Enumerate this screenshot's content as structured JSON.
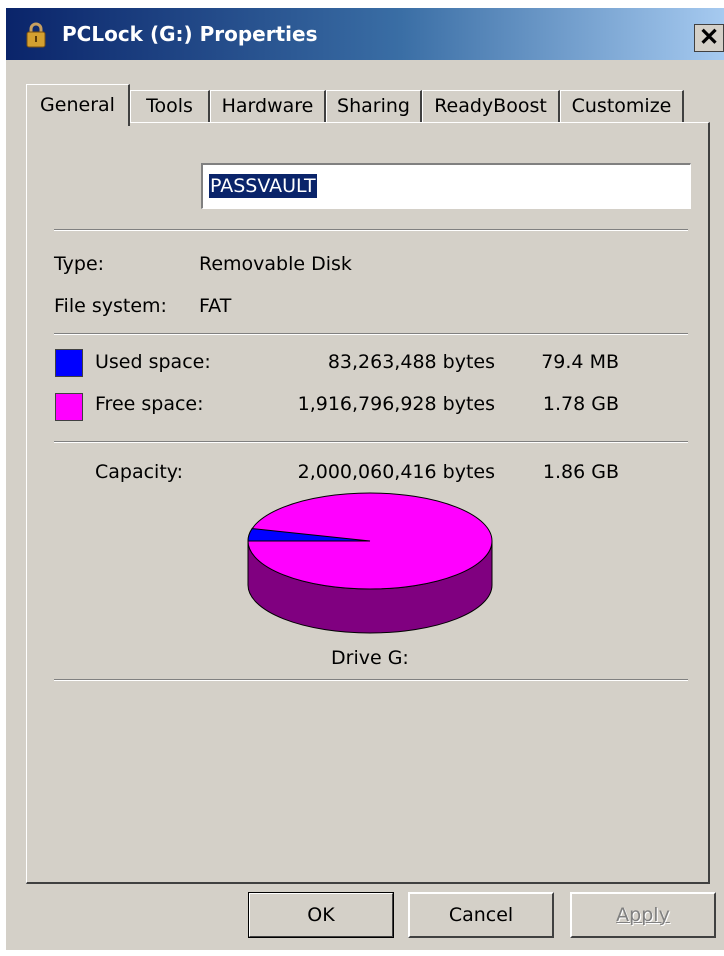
{
  "window": {
    "title": "PCLock (G:) Properties",
    "close_glyph": "✕"
  },
  "tabs": [
    {
      "label": "General",
      "active": true
    },
    {
      "label": "Tools",
      "active": false
    },
    {
      "label": "Hardware",
      "active": false
    },
    {
      "label": "Sharing",
      "active": false
    },
    {
      "label": "ReadyBoost",
      "active": false
    },
    {
      "label": "Customize",
      "active": false
    }
  ],
  "general": {
    "volume_label": "PASSVAULT",
    "type_label": "Type:",
    "type_value": "Removable Disk",
    "fs_label": "File system:",
    "fs_value": "FAT",
    "used_label": "Used space:",
    "used_bytes": "83,263,488 bytes",
    "used_size": "79.4 MB",
    "free_label": "Free space:",
    "free_bytes": "1,916,796,928 bytes",
    "free_size": "1.78 GB",
    "capacity_label": "Capacity:",
    "capacity_bytes": "2,000,060,416 bytes",
    "capacity_size": "1.86 GB",
    "drive_label": "Drive G:"
  },
  "colors": {
    "used": "#0000ff",
    "free": "#ff00ff",
    "free_side": "#800080",
    "used_side": "#000080"
  },
  "chart_data": {
    "type": "pie",
    "categories": [
      "Used space",
      "Free space"
    ],
    "values": [
      83263488,
      1916796928
    ]
  },
  "buttons": {
    "ok": "OK",
    "cancel": "Cancel",
    "apply": "Apply"
  },
  "icons": {
    "title": "padlock-icon"
  }
}
